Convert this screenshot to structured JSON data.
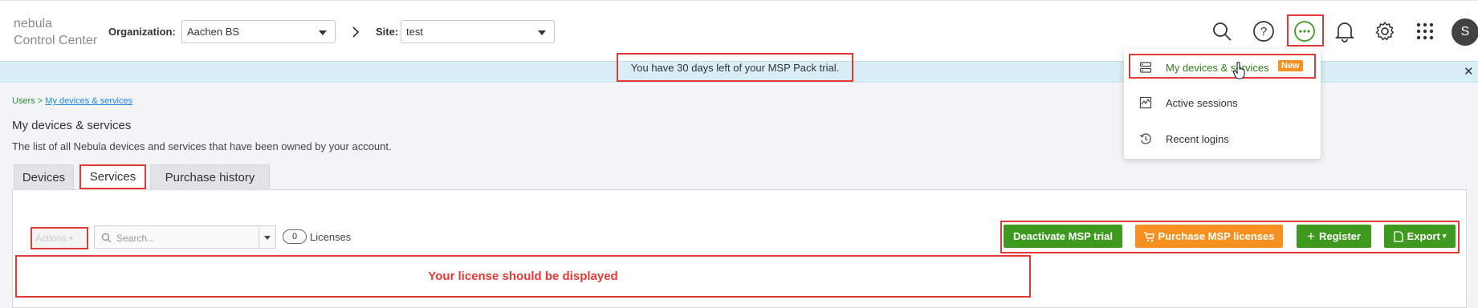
{
  "app": {
    "logo_line1": "nebula",
    "logo_line2": "Control Center"
  },
  "header": {
    "org_label": "Organization:",
    "org_value": "Aachen BS",
    "site_label": "Site:",
    "site_value": "test",
    "avatar_initial": "S",
    "icons": [
      "search-icon",
      "help-icon",
      "more-icon",
      "bell-icon",
      "gear-icon",
      "apps-grid-icon"
    ]
  },
  "banner": {
    "text": "You have 30 days left of your MSP Pack trial.",
    "close": "✕"
  },
  "dropdown": {
    "items": [
      {
        "label": "My devices & services",
        "icon": "devices-icon",
        "badge": "New"
      },
      {
        "label": "Active sessions",
        "icon": "activity-icon"
      },
      {
        "label": "Recent logins",
        "icon": "history-icon"
      }
    ]
  },
  "breadcrumb": {
    "parent": "Users",
    "separator": " > ",
    "current": "My devices & services"
  },
  "page": {
    "title": "My devices & services",
    "description": "The list of all Nebula devices and services that have been owned by your account."
  },
  "tabs": [
    {
      "label": "Devices"
    },
    {
      "label": "Services"
    },
    {
      "label": "Purchase history"
    }
  ],
  "toolbar": {
    "actions_label": "Actions",
    "search_placeholder": "Search...",
    "license_count": "0",
    "license_label": "Licenses",
    "deactivate_label": "Deactivate MSP trial",
    "purchase_label": "Purchase MSP licenses",
    "register_label": "Register",
    "export_label": "Export"
  },
  "annotation": {
    "message": "Your license should be displayed"
  },
  "colors": {
    "accent_green": "#3e9a1f",
    "accent_orange": "#f6901e",
    "highlight_red": "#e53935",
    "banner_blue": "#d9edf7"
  }
}
